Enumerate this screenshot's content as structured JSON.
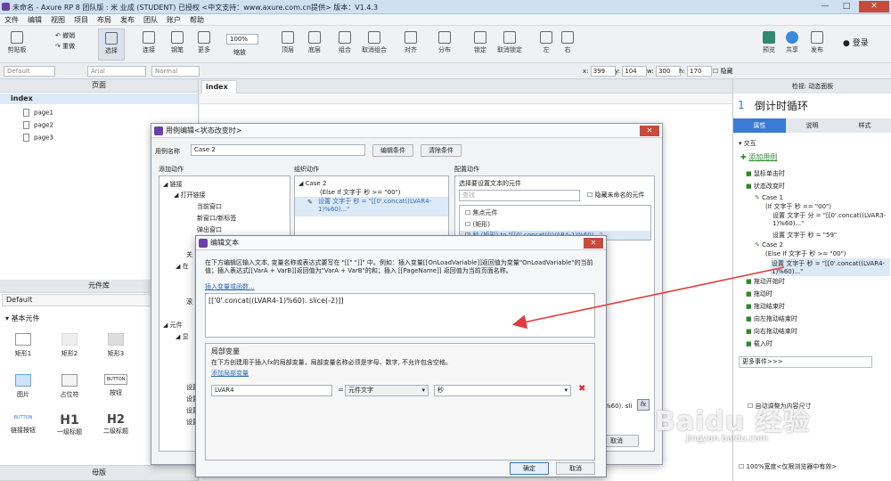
{
  "window": {
    "title": "未命名 - Axure RP 8 团队版 : 米 业成 (STUDENT) 已授权      <中文支持：www.axure.com.cn提供> 版本：V1.4.3",
    "min": "—",
    "max": "□",
    "close": "✕"
  },
  "menu": [
    "文件",
    "编辑",
    "视图",
    "项目",
    "布局",
    "发布",
    "团队",
    "账户",
    "帮助"
  ],
  "toolbar": {
    "left": [
      {
        "label": "剪贴板",
        "icon": "clipboard-icon"
      },
      {
        "label": "选择",
        "icon": "select-icon"
      },
      {
        "label": "连接",
        "icon": "connect-icon"
      },
      {
        "label": "钢笔",
        "icon": "pen-icon"
      },
      {
        "label": "更多",
        "icon": "more-icon"
      }
    ],
    "undo": "撤销",
    "redo": "重做",
    "zoom": "100%",
    "zoom_label": "缩放",
    "mid": [
      {
        "label": "顶层",
        "icon": "front-icon"
      },
      {
        "label": "底层",
        "icon": "back-icon"
      },
      {
        "label": "组合",
        "icon": "group-icon"
      },
      {
        "label": "取消组合",
        "icon": "ungroup-icon"
      },
      {
        "label": "对齐",
        "icon": "align-icon"
      },
      {
        "label": "分布",
        "icon": "distribute-icon"
      },
      {
        "label": "锁定",
        "icon": "lock-icon"
      },
      {
        "label": "取消锁定",
        "icon": "unlock-icon"
      },
      {
        "label": "左",
        "icon": "left-icon"
      },
      {
        "label": "右",
        "icon": "right-icon"
      }
    ],
    "right": [
      {
        "label": "预览",
        "icon": "preview-icon"
      },
      {
        "label": "共享",
        "icon": "share-icon"
      },
      {
        "label": "发布",
        "icon": "publish-icon"
      }
    ],
    "login": "登录"
  },
  "format": {
    "style": "Default",
    "font": "Arial",
    "weight": "Normal",
    "x_label": "x:",
    "x": "399",
    "y_label": "y:",
    "y": "104",
    "w_label": "w:",
    "w": "300",
    "h_label": "h:",
    "h": "170",
    "hide": "隐藏"
  },
  "pages": {
    "title": "页面",
    "root": "index",
    "items": [
      "page1",
      "page2",
      "page3"
    ]
  },
  "library": {
    "title": "元件库",
    "select": "Default",
    "group": "基本元件",
    "widgets": [
      "矩形1",
      "矩形2",
      "矩形3",
      "图片",
      "占位符",
      "按钮",
      "链接按钮",
      "一级标题",
      "二级标题"
    ],
    "h1": "H1",
    "h2": "H2",
    "button_text": "BUTTON",
    "masters": "母版"
  },
  "canvas": {
    "tab": "index"
  },
  "inspector": {
    "header": "检视: 动态面板",
    "num": "1",
    "name": "倒计时循环",
    "tabs": [
      "属性",
      "说明",
      "样式"
    ],
    "interaction": "交互",
    "add_case": "添加用例",
    "events": [
      "鼠标单击时",
      "状态改变时"
    ],
    "case1": "Case 1",
    "case1_cond": "(If 文字于 秒 == \"00\")",
    "case1_a1": "设置 文字于 分 = \"[[0'.concat((LVAR3-1)%60)...\"",
    "case1_a2": "设置 文字于 秒 = \"59\"",
    "case2": "Case 2",
    "case2_cond": "(Else If 文字于 秒 >= \"00\")",
    "case2_a1": "设置 文字于 秒 = \"[[0'.concat((LVAR4-1)%60)...\"",
    "events2": [
      "拖动开始时",
      "拖动时",
      "拖动结束时",
      "向左拖动结束时",
      "向右拖动结束时",
      "载入时"
    ],
    "more": "更多事件>>>",
    "bottom1": "自动调整为内容尺寸",
    "bottom2": "100%宽度<仅限浏览器中有效>"
  },
  "case_dialog": {
    "title": "用例编辑<状态改变时>",
    "name_label": "用例名称",
    "name": "Case 2",
    "edit_cond": "编辑条件",
    "clear_cond": "清除条件",
    "col1": "添加动作",
    "col2": "组织动作",
    "col3": "配置动作",
    "actions": [
      "链接",
      "打开链接",
      "当前窗口",
      "新窗口/新标签",
      "弹出窗口",
      "关",
      "在",
      "滚",
      "元件",
      "显"
    ],
    "org_case": "Case 2",
    "org_cond": "(Else If 文字于 秒 >= \"00\")",
    "org_act": "设置 文字于 秒 = \"[[0'.concat((LVAR4-1)%60)...\"",
    "cfg_title": "选择要设置文本的元件",
    "search": "查找",
    "hide_unnamed": "隐藏未命名的元件",
    "focus": "焦点元件",
    "rect": "(矩形)",
    "sec": "秒 (矩形) to \"[[0'.concat((LVAR4-1)%60)...\"",
    "sli": "%60). sli",
    "fx": "fx",
    "ok": "确定",
    "cancel": "取消",
    "left_bottom": [
      "设置",
      "设置",
      "设置",
      "设置"
    ]
  },
  "edit_dialog": {
    "title": "编辑文本",
    "desc": "在下方编辑区输入文本, 变量名称或表达式要写在 \"[[\" \"]]\" 中。例如：插入变量[[OnLoadVariable]]返回值为变量\"OnLoadVariable\"的当前值；插入表达式[[VarA + VarB]]返回值为\"VarA + VarB\"的和；插入 [[PageName]] 返回值为当前页面名称。",
    "insert": "插入变量或函数...",
    "expr": "[['0'.concat((LVAR4-1)%60). slice(-2)]]",
    "local_title": "局部变量",
    "local_desc": "在下方创建用于插入fx的局部变量，局部变量名称必须是字母、数字, 不允许包含空格。",
    "add_local": "添加局部变量",
    "var_name": "LVAR4",
    "eq": "=",
    "var_type": "元件文字",
    "var_target": "秒",
    "ok": "确定",
    "cancel": "取消"
  },
  "watermark": {
    "main": "Baidu 经验",
    "sub": "jingyan.baidu.com"
  }
}
